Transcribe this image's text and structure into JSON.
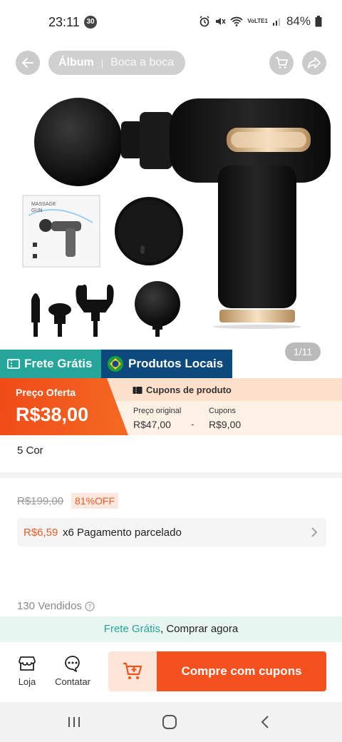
{
  "status_bar": {
    "time": "23:11",
    "notification_count": "30",
    "network_label": "VoLTE1",
    "battery": "84%"
  },
  "nav": {
    "tab_album": "Álbum",
    "tab_word_of_mouth": "Boca a boca",
    "back_icon": "arrow-left-icon",
    "cart_icon": "cart-icon",
    "share_icon": "share-icon"
  },
  "gallery": {
    "box_text_line1": "MASSAGE",
    "box_text_line2": "GUN",
    "counter": "1/11"
  },
  "badges": {
    "free_shipping": "Frete Grátis",
    "local_products": "Produtos Locais"
  },
  "price": {
    "offer_label": "Preço Oferta",
    "offer_price": "R$38,00",
    "coupons_title": "Cupons de produto",
    "original_label": "Preço original",
    "original_value": "R$47,00",
    "minus": "-",
    "coupons_label": "Cupons",
    "coupons_value": "R$9,00"
  },
  "variants": {
    "text": "5 Cor"
  },
  "pricing_detail": {
    "old_price": "R$199,00",
    "discount": "81%OFF",
    "installment_price": "R$6,59",
    "installment_text": "x6 Pagamento parcelado"
  },
  "sales": {
    "sold": "130 Vendidos"
  },
  "promo": {
    "highlight": "Frete Grátis",
    "rest": ", Comprar agora"
  },
  "bottom_bar": {
    "store_label": "Loja",
    "chat_label": "Contatar",
    "buy_label": "Compre com cupons"
  },
  "colors": {
    "accent_orange": "#f4511e",
    "teal": "#26a69a",
    "navy": "#0c4a7d",
    "coupon_bg": "#fdf1e6"
  }
}
